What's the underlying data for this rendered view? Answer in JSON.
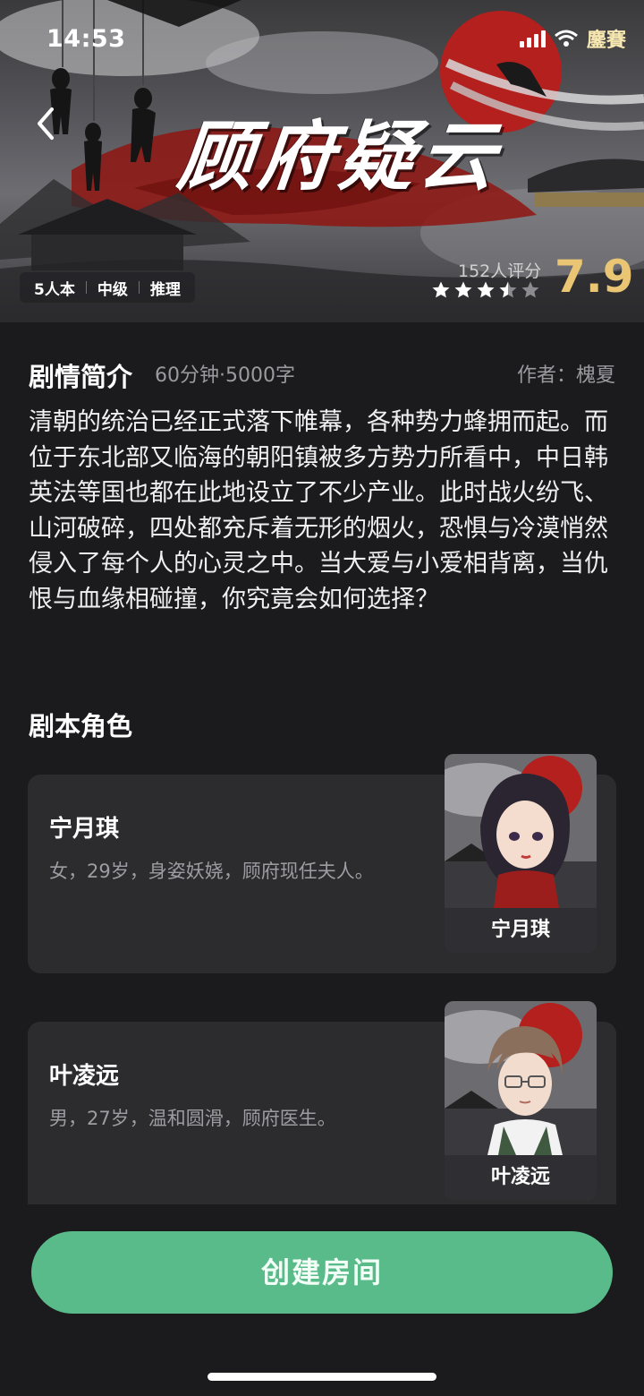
{
  "status_bar": {
    "time": "14:53",
    "battery_text": "鏖賽"
  },
  "banner": {
    "title": "顾府疑云",
    "tags": [
      "5人本",
      "中级",
      "推理"
    ],
    "rating_count": "152人评分",
    "score": "7.9",
    "stars": {
      "value": 3.5,
      "max": 5
    }
  },
  "synopsis": {
    "heading": "剧情简介",
    "meta": "60分钟·5000字",
    "author": "作者：槐夏",
    "text": "清朝的统治已经正式落下帷幕，各种势力蜂拥而起。而位于东北部又临海的朝阳镇被多方势力所看中，中日韩英法等国也都在此地设立了不少产业。此时战火纷飞、山河破碎，四处都充斥着无形的烟火，恐惧与冷漠悄然侵入了每个人的心灵之中。当大爱与小爱相背离，当仇恨与血缘相碰撞，你究竟会如何选择？"
  },
  "roles": {
    "heading": "剧本角色",
    "items": [
      {
        "name": "宁月琪",
        "desc": "女，29岁，身姿妖娆，顾府现任夫人。",
        "portrait_label": "宁月琪"
      },
      {
        "name": "叶凌远",
        "desc": "男，27岁，温和圆滑，顾府医生。",
        "portrait_label": "叶凌远"
      }
    ]
  },
  "actions": {
    "create_room": "创建房间"
  },
  "colors": {
    "accent": "#59bb8a",
    "score": "#e9c574",
    "background": "#1b1b1d",
    "card": "#2c2c2f"
  }
}
